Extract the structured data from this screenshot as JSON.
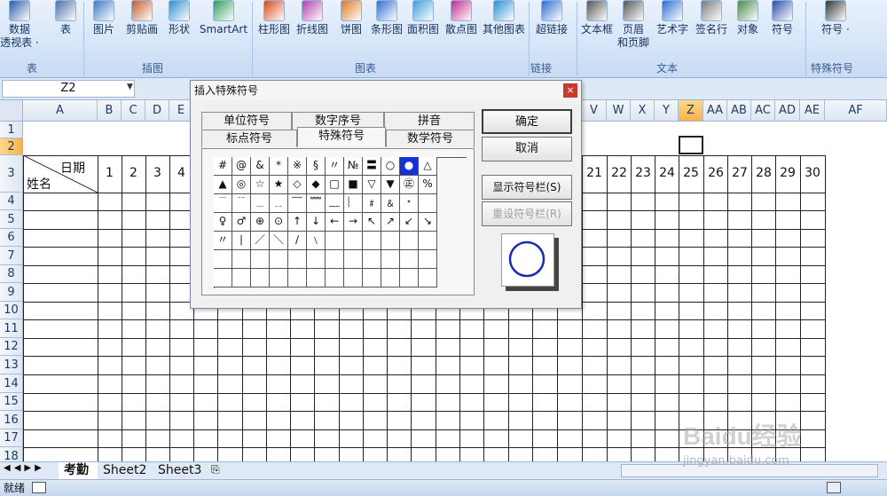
{
  "ribbon": {
    "buttons": [
      {
        "label": "数据",
        "label2": "透视表 ·",
        "icon": "pivot-table-icon"
      },
      {
        "label": "表",
        "label2": "",
        "icon": "table-icon"
      },
      {
        "label": "图片",
        "label2": "",
        "icon": "picture-icon"
      },
      {
        "label": "剪贴画",
        "label2": "",
        "icon": "clipart-icon"
      },
      {
        "label": "形状",
        "label2": "",
        "icon": "shapes-icon"
      },
      {
        "label": "SmartArt",
        "label2": "",
        "icon": "smartart-icon"
      },
      {
        "label": "柱形图",
        "label2": "",
        "icon": "column-chart-icon"
      },
      {
        "label": "折线图",
        "label2": "",
        "icon": "line-chart-icon"
      },
      {
        "label": "饼图",
        "label2": "",
        "icon": "pie-chart-icon"
      },
      {
        "label": "条形图",
        "label2": "",
        "icon": "bar-chart-icon"
      },
      {
        "label": "面积图",
        "label2": "",
        "icon": "area-chart-icon"
      },
      {
        "label": "散点图",
        "label2": "",
        "icon": "scatter-chart-icon"
      },
      {
        "label": "其他图表",
        "label2": "",
        "icon": "other-charts-icon"
      },
      {
        "label": "超链接",
        "label2": "",
        "icon": "hyperlink-icon"
      },
      {
        "label": "文本框",
        "label2": "",
        "icon": "textbox-icon"
      },
      {
        "label": "页眉",
        "label2": "和页脚",
        "icon": "header-footer-icon"
      },
      {
        "label": "艺术字",
        "label2": "",
        "icon": "wordart-icon"
      },
      {
        "label": "签名行",
        "label2": "",
        "icon": "signature-icon"
      },
      {
        "label": "对象",
        "label2": "",
        "icon": "object-icon"
      },
      {
        "label": "符号",
        "label2": "",
        "icon": "symbol-icon"
      },
      {
        "label": "符号 ·",
        "label2": "",
        "icon": "special-symbol-icon"
      }
    ],
    "groups": [
      "表",
      "插图",
      "图表",
      "链接",
      "文本",
      "特殊符号"
    ]
  },
  "namebox": {
    "value": "Z2"
  },
  "columns": [
    "A",
    "B",
    "C",
    "D",
    "E",
    "V",
    "W",
    "X",
    "Y",
    "Z",
    "AA",
    "AB",
    "AC",
    "AD",
    "AE",
    "AF"
  ],
  "rows": [
    "1",
    "2",
    "3",
    "4",
    "5",
    "6",
    "7",
    "8",
    "9",
    "10",
    "11",
    "12",
    "13",
    "14",
    "15",
    "16",
    "17",
    "18"
  ],
  "sheet": {
    "header_date": "日期",
    "header_name": "姓名",
    "days_left": [
      "1",
      "2",
      "3",
      "4"
    ],
    "days_right": [
      "21",
      "22",
      "23",
      "24",
      "25",
      "26",
      "27",
      "28",
      "29",
      "30"
    ]
  },
  "sheet_tabs": [
    "考勤",
    "Sheet2",
    "Sheet3"
  ],
  "status": {
    "ready": "就绪"
  },
  "dialog": {
    "title": "插入特殊符号",
    "close": "×",
    "tabs_back": [
      "单位符号",
      "数字序号",
      "拼音"
    ],
    "tabs_front": [
      "标点符号",
      "特殊符号",
      "数学符号"
    ],
    "active_tab": "特殊符号",
    "symbols": [
      [
        "#",
        "@",
        "&",
        "*",
        "※",
        "§",
        "〃",
        "№",
        "〓",
        "○",
        "●",
        "△"
      ],
      [
        "▲",
        "◎",
        "☆",
        "★",
        "◇",
        "◆",
        "□",
        "■",
        "▽",
        "▼",
        "㊣",
        "%"
      ],
      [
        "﹉",
        "﹊",
        "﹍",
        "﹎",
        "﹋",
        "﹌",
        "﹏",
        "︴",
        "﹟",
        "﹠",
        "﹡",
        ""
      ],
      [
        "♀",
        "♂",
        "⊕",
        "⊙",
        "↑",
        "↓",
        "←",
        "→",
        "↖",
        "↗",
        "↙",
        "↘"
      ],
      [
        "〃",
        "∣",
        "／",
        "＼",
        "∕",
        "﹨",
        "",
        "",
        "",
        "",
        "",
        ""
      ],
      [
        "",
        "",
        "",
        "",
        "",
        "",
        "",
        "",
        "",
        "",
        "",
        ""
      ],
      [
        "",
        "",
        "",
        "",
        "",
        "",
        "",
        "",
        "",
        "",
        "",
        ""
      ]
    ],
    "selected_symbol": "●",
    "buttons": {
      "ok": "确定",
      "cancel": "取消",
      "show_bar": "显示符号栏(S)",
      "reset_bar": "重设符号栏(R)"
    },
    "preview_symbol": "○"
  },
  "watermark": {
    "brand": "Baidu经验",
    "url": "jingyan.baidu.com"
  }
}
